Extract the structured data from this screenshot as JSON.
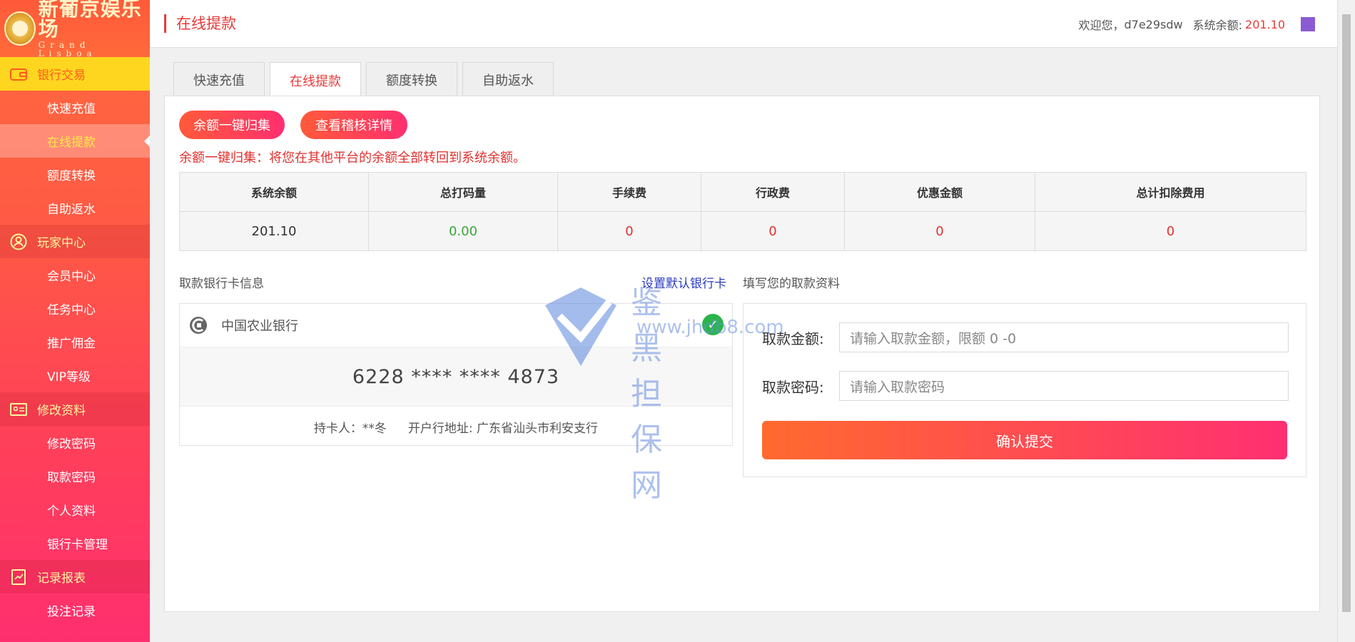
{
  "brand": {
    "name_cn": "新葡京娱乐场",
    "name_en": "Grand Lisboa"
  },
  "sidebar": {
    "groups": [
      {
        "label": "银行交易",
        "icon": "wallet-icon",
        "items": [
          "快速充值",
          "在线提款",
          "额度转换",
          "自助返水"
        ]
      },
      {
        "label": "玩家中心",
        "icon": "user-icon",
        "items": [
          "会员中心",
          "任务中心",
          "推广佣金",
          "VIP等级"
        ]
      },
      {
        "label": "修改资料",
        "icon": "id-card-icon",
        "items": [
          "修改密码",
          "取款密码",
          "个人资料",
          "银行卡管理"
        ]
      },
      {
        "label": "记录报表",
        "icon": "report-icon",
        "items": [
          "投注记录"
        ]
      }
    ],
    "current_item": "在线提款"
  },
  "header": {
    "title": "在线提款",
    "welcome": "欢迎您，",
    "username": "d7e29sdw",
    "balance_label": "系统余额:",
    "balance_value": "201.10"
  },
  "tabs": [
    "快速充值",
    "在线提款",
    "额度转换",
    "自助返水"
  ],
  "active_tab": "在线提款",
  "actions": {
    "collect": "余额一键归集",
    "audit": "查看稽核详情"
  },
  "note": "余额一键归集：将您在其他平台的余额全部转回到系统余额。",
  "stats": {
    "headers": [
      "系统余额",
      "总打码量",
      "手续费",
      "行政费",
      "优惠金额",
      "总计扣除费用"
    ],
    "values": [
      "201.10",
      "0.00",
      "0",
      "0",
      "0",
      "0"
    ]
  },
  "bank_section": {
    "label": "取款银行卡信息",
    "set_default": "设置默认银行卡",
    "fill_label": "填写您的取款资料"
  },
  "card": {
    "bank": "中国农业银行",
    "number": "6228 **** **** 4873",
    "holder": "持卡人：**冬",
    "branch": "开户行地址: 广东省汕头市利安支行"
  },
  "form": {
    "amount_label": "取款金额:",
    "amount_placeholder": "请输入取款金额，限额 0 -0",
    "password_label": "取款密码:",
    "password_placeholder": "请输入取款密码",
    "submit": "确认提交"
  },
  "watermark": {
    "cn": "鉴黑担保网",
    "en": "www.jhdb8.com"
  },
  "colors": {
    "accent": "#e73a3a",
    "sidebar_start": "#ff6a3d",
    "sidebar_end": "#ff2f6f",
    "active_group": "#ffd61f"
  }
}
